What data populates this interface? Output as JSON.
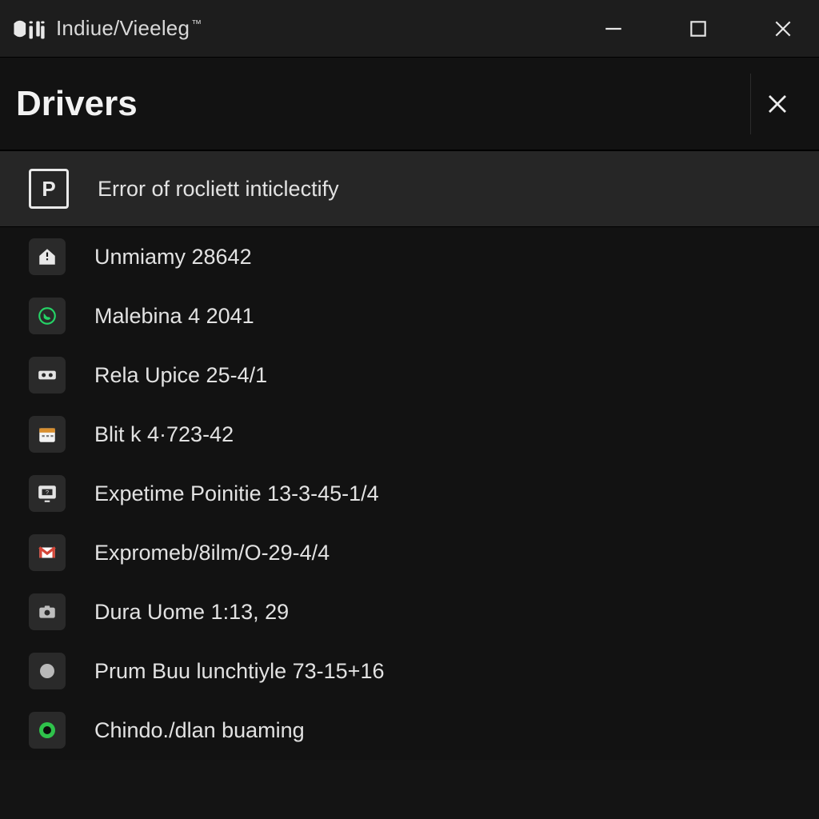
{
  "titlebar": {
    "app_title": "Indiue/Vieeleg",
    "trademark": "™"
  },
  "panel": {
    "title": "Drivers"
  },
  "list": {
    "selected": {
      "icon": "p-badge-icon",
      "label": "Error of rocliett inticlectify"
    },
    "items": [
      {
        "icon": "house-alert-icon",
        "label": "Unmiamy 28642"
      },
      {
        "icon": "whatsapp-icon",
        "label": "Malebina 4 2041"
      },
      {
        "icon": "tape-icon",
        "label": "Rela Upice 25-4/1"
      },
      {
        "icon": "calendar-icon",
        "label": "Blit k 4·723-42"
      },
      {
        "icon": "monitor-icon",
        "label": "Expetime Poinitie 13-3-45-1/4"
      },
      {
        "icon": "gmail-icon",
        "label": "Expromeb/8ilm/O-29-4/4"
      },
      {
        "icon": "camera-icon",
        "label": "Dura Uome 1:13, 29"
      },
      {
        "icon": "disc-icon",
        "label": "Prum Buu lunchtiyle 73-15+16"
      },
      {
        "icon": "power-dot-icon",
        "label": "Chindo./dlan buaming"
      }
    ]
  }
}
